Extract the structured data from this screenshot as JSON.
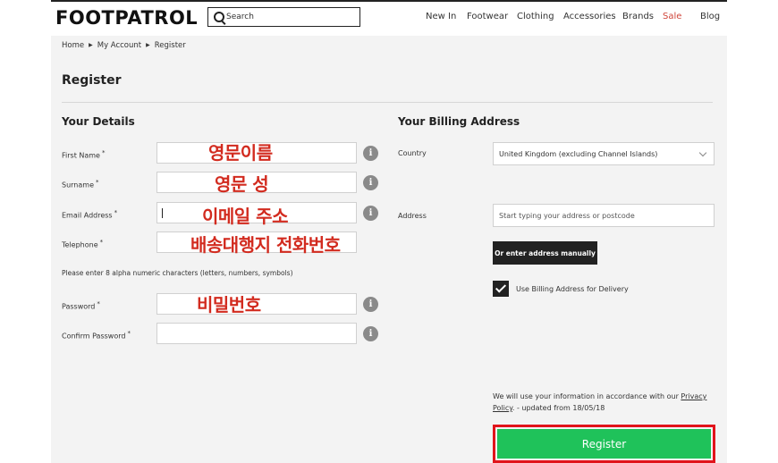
{
  "header": {
    "logo": "FOOTPATROL",
    "search_placeholder": "Search",
    "nav": [
      {
        "label": "New In"
      },
      {
        "label": "Footwear"
      },
      {
        "label": "Clothing"
      },
      {
        "label": "Accessories"
      },
      {
        "label": "Brands"
      },
      {
        "label": "Sale",
        "color": "#d0453b"
      },
      {
        "label": "Blog"
      }
    ]
  },
  "breadcrumb": [
    "Home",
    "My Account",
    "Register"
  ],
  "page_title": "Register",
  "details": {
    "heading": "Your Details",
    "fields": [
      {
        "label": "First Name",
        "required": "*"
      },
      {
        "label": "Surname",
        "required": "*"
      },
      {
        "label": "Email Address",
        "required": "*"
      },
      {
        "label": "Telephone",
        "required": "*"
      },
      {
        "label": "Password",
        "required": "*"
      },
      {
        "label": "Confirm Password",
        "required": "*"
      }
    ],
    "password_hint": "Please enter 8 alpha numeric characters (letters, numbers, symbols)",
    "info_glyph": "i"
  },
  "annotations": [
    "영문이름",
    "영문 성",
    "이메일 주소",
    "배송대행지 전화번호",
    "비밀번호"
  ],
  "billing": {
    "heading": "Your Billing Address",
    "country_label": "Country",
    "country_value": "United Kingdom (excluding Channel Islands)",
    "address_label": "Address",
    "address_placeholder": "Start typing your address or postcode",
    "manual_button": "Or enter address manually",
    "use_billing_label": "Use Billing Address for Delivery"
  },
  "privacy": {
    "before": "We will use your information in accordance with our ",
    "link": "Privacy Policy",
    "after": ". - updated from 18/05/18"
  },
  "register_button": "Register",
  "colors": {
    "accent_green": "#1fc25a",
    "highlight_red": "#e1141b",
    "annotation_red": "#d22b1f"
  }
}
